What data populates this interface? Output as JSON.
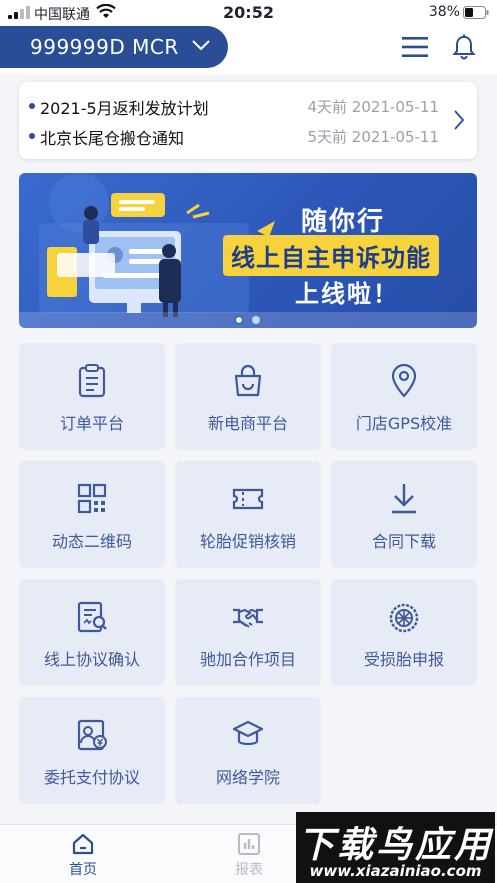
{
  "status_bar": {
    "carrier": "中国联通",
    "time": "20:52",
    "battery": "38%"
  },
  "header": {
    "account": "999999D MCR"
  },
  "notices": [
    {
      "title": "2021-5月返利发放计划",
      "date": "4天前 2021-05-11"
    },
    {
      "title": "北京长尾仓搬仓通知",
      "date": "5天前 2021-05-11"
    }
  ],
  "banner": {
    "line1": "随你行",
    "line2": "线上自主申诉功能",
    "line3": "上线啦！",
    "active_slide": 1,
    "slide_count": 2
  },
  "grid": [
    {
      "label": "订单平台",
      "icon": "clipboard-icon"
    },
    {
      "label": "新电商平台",
      "icon": "shopping-bag-icon"
    },
    {
      "label": "门店GPS校准",
      "icon": "map-pin-icon"
    },
    {
      "label": "动态二维码",
      "icon": "qr-code-icon"
    },
    {
      "label": "轮胎促销核销",
      "icon": "ticket-icon"
    },
    {
      "label": "合同下载",
      "icon": "download-icon"
    },
    {
      "label": "线上协议确认",
      "icon": "document-search-icon"
    },
    {
      "label": "驰加合作项目",
      "icon": "handshake-icon"
    },
    {
      "label": "受损胎申报",
      "icon": "tire-icon"
    },
    {
      "label": "委托支付协议",
      "icon": "payment-agreement-icon"
    },
    {
      "label": "网络学院",
      "icon": "graduation-cap-icon"
    }
  ],
  "tabs": [
    {
      "label": "首页",
      "icon": "home-icon",
      "active": true
    },
    {
      "label": "报表",
      "icon": "bar-chart-icon",
      "active": false
    }
  ],
  "watermark": {
    "line1": "下载鸟应用",
    "line2": "www.xiazainiao.com"
  },
  "colors": {
    "brand": "#2a4e96",
    "tile_bg": "#e6ebf6",
    "tile_text": "#3f5a9a",
    "highlight": "#f6d23c"
  }
}
